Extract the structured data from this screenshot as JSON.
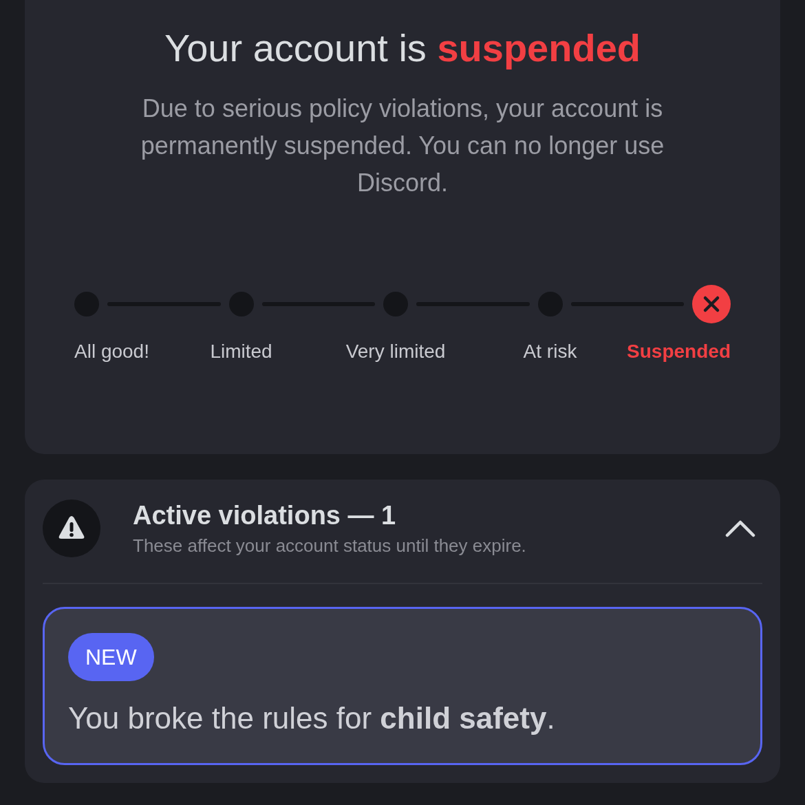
{
  "status": {
    "heading": "Your account is **suspended**",
    "description": "Due to serious policy violations, your account is permanently suspended. You can no longer use Discord."
  },
  "steps": [
    {
      "label": "All good!",
      "selected": false
    },
    {
      "label": "Limited",
      "selected": false
    },
    {
      "label": "Very limited",
      "selected": false
    },
    {
      "label": "At risk",
      "selected": false
    },
    {
      "label": "Suspended",
      "selected": true
    }
  ],
  "violations": {
    "title": "Active violations — 1",
    "subtitle": "These affect your account status until they expire.",
    "expanded": true,
    "items": [
      {
        "badge": "NEW",
        "text": "You broke the rules for **child safety**."
      }
    ]
  }
}
